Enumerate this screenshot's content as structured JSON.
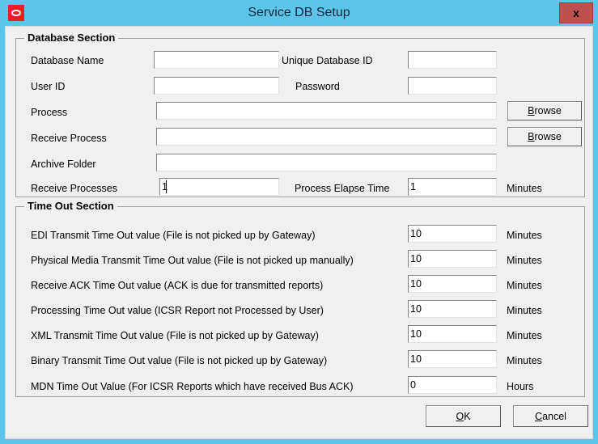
{
  "window": {
    "title": "Service DB Setup",
    "app_icon": "oracle-logo-icon",
    "close_label": "x",
    "chrome_color": "#5ec5ea",
    "close_color": "#c0504d",
    "client_color": "#f0f0f0"
  },
  "database_section": {
    "legend": "Database Section",
    "fields": {
      "database_name": {
        "label": "Database Name",
        "value": "",
        "placeholder": ""
      },
      "unique_database_id": {
        "label": "Unique Database ID",
        "value": "",
        "placeholder": ""
      },
      "user_id": {
        "label": "User ID",
        "value": "",
        "placeholder": ""
      },
      "password": {
        "label": "Password",
        "value": "",
        "placeholder": ""
      },
      "process": {
        "label": "Process",
        "value": "",
        "placeholder": ""
      },
      "receive_process": {
        "label": "Receive Process",
        "value": "",
        "placeholder": ""
      },
      "archive_folder": {
        "label": "Archive Folder",
        "value": "",
        "placeholder": ""
      },
      "receive_processes": {
        "label": "Receive Processes",
        "value": "1",
        "placeholder": ""
      },
      "process_elapse_time": {
        "label": "Process Elapse Time",
        "value": "1",
        "placeholder": "",
        "unit": "Minutes"
      }
    },
    "browse_process": "Browse",
    "browse_receive_process": "Browse"
  },
  "timeout_section": {
    "legend": "Time Out Section",
    "rows": [
      {
        "label": "EDI Transmit Time Out value  (File is not picked up by Gateway)",
        "value": "10",
        "unit": "Minutes"
      },
      {
        "label": "Physical Media Transmit Time Out value (File is not picked up manually)",
        "value": "10",
        "unit": "Minutes"
      },
      {
        "label": "Receive ACK Time Out value (ACK is due for transmitted reports)",
        "value": "10",
        "unit": "Minutes"
      },
      {
        "label": "Processing Time Out value  (ICSR Report not Processed by User)",
        "value": "10",
        "unit": "Minutes"
      },
      {
        "label": "XML Transmit Time Out value (File is not picked up by Gateway)",
        "value": "10",
        "unit": "Minutes"
      },
      {
        "label": "Binary Transmit Time Out value (File is not picked up by Gateway)",
        "value": "10",
        "unit": "Minutes"
      },
      {
        "label": "MDN Time Out Value (For ICSR Reports which have received Bus ACK)",
        "value": "0",
        "unit": "Hours"
      }
    ]
  },
  "footer": {
    "ok_label": "OK",
    "ok_mnemonic": "O",
    "cancel_label": "Cancel",
    "cancel_mnemonic": "C"
  }
}
